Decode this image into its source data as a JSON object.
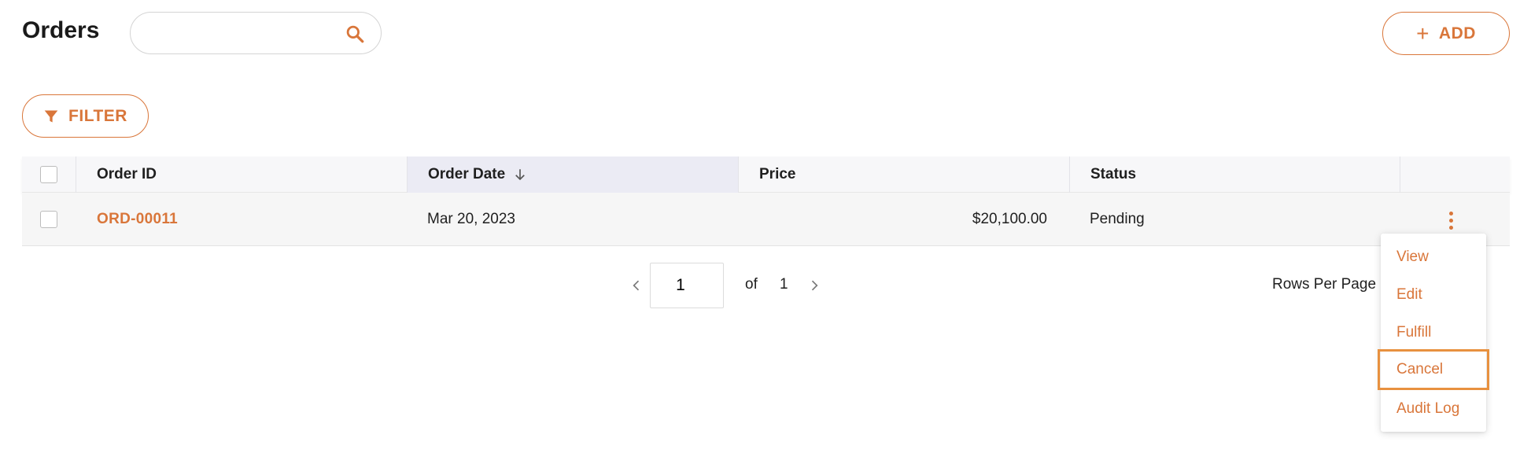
{
  "header": {
    "title": "Orders",
    "search": {
      "value": "",
      "placeholder": ""
    },
    "add_label": "ADD"
  },
  "toolbar": {
    "filter_label": "FILTER"
  },
  "table": {
    "columns": [
      "Order ID",
      "Order Date",
      "Price",
      "Status"
    ],
    "sorted_column": "Order Date",
    "sort_direction": "descending",
    "rows": [
      {
        "order_id": "ORD-00011",
        "order_date": "Mar 20, 2023",
        "price": "$20,100.00",
        "status": "Pending"
      }
    ]
  },
  "pagination": {
    "current_page": "1",
    "of_label": "of",
    "total_pages": "1",
    "rows_per_page_label": "Rows Per Page"
  },
  "action_menu": {
    "items": [
      "View",
      "Edit",
      "Fulfill",
      "Cancel",
      "Audit Log"
    ],
    "focused_item": "Cancel"
  },
  "colors": {
    "accent": "#d9763a",
    "focus_outline": "#e8913f",
    "header_bg": "#f7f7f9",
    "sorted_header_bg": "#ebebf4",
    "row_bg": "#f6f6f6"
  },
  "icons": {
    "search": "search-icon",
    "add": "plus-icon",
    "filter": "filter-icon",
    "sort": "arrow-down-icon",
    "row_actions": "kebab-menu-icon",
    "prev": "chevron-left-icon",
    "next": "chevron-right-icon"
  }
}
